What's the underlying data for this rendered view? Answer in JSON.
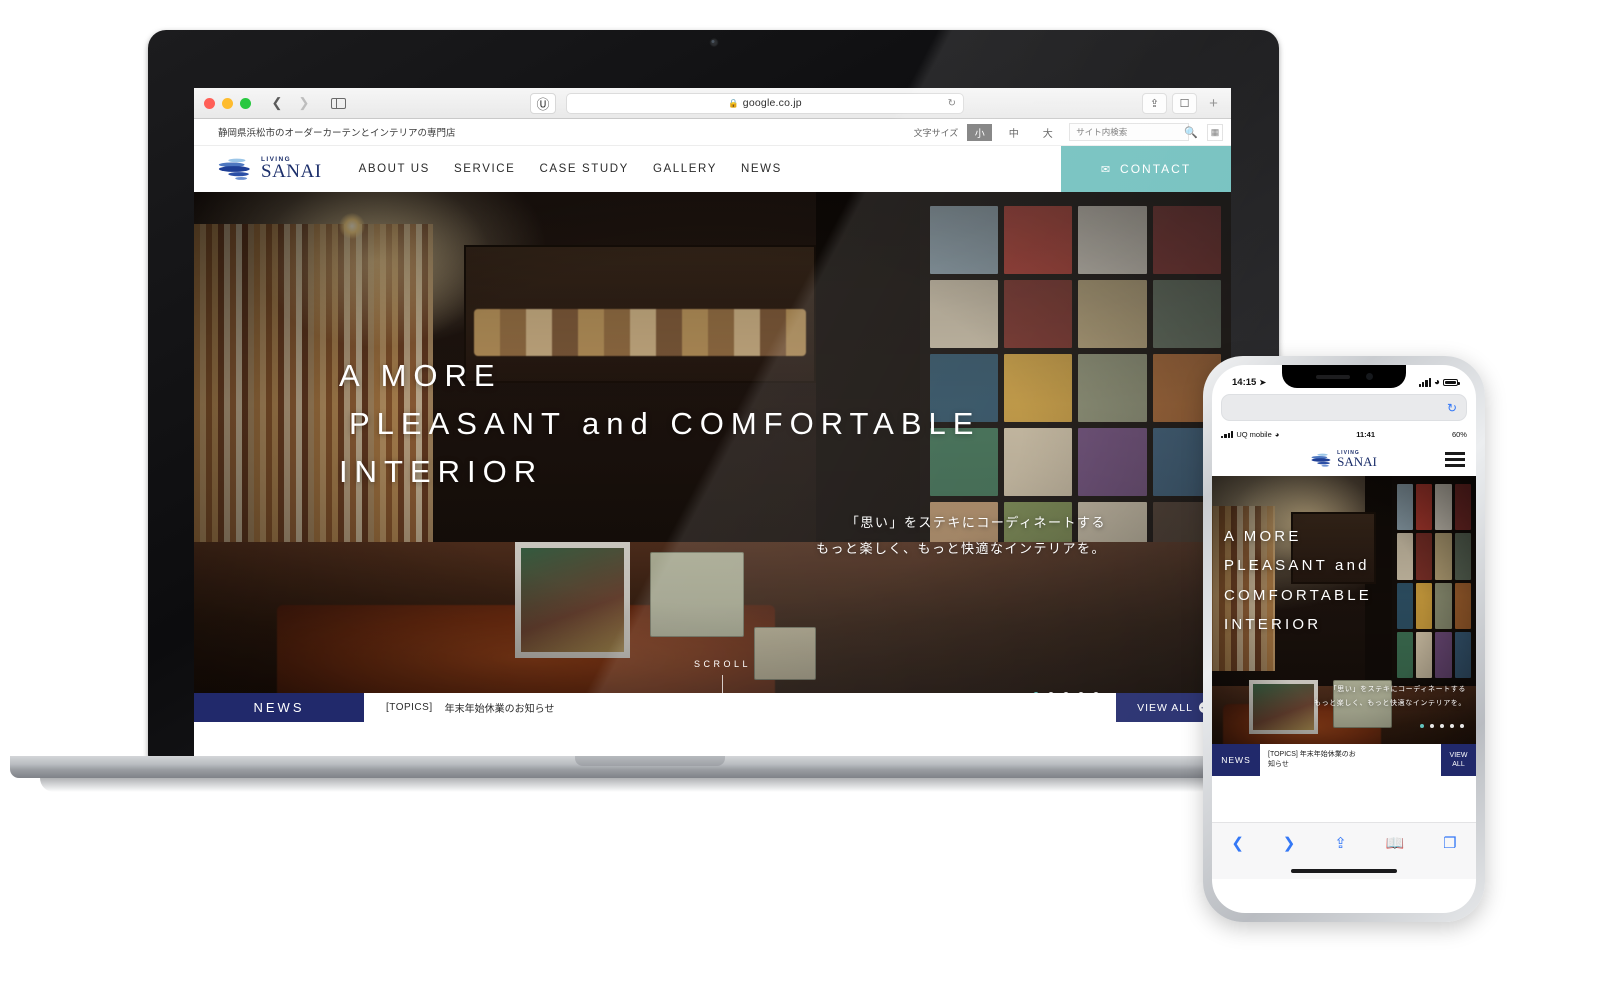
{
  "browser": {
    "url": "google.co.jp",
    "lock_icon": "lock-icon",
    "pinterest_icon": "pinterest-icon",
    "reload_icon": "reload-icon",
    "back_icon": "chevron-left-icon",
    "forward_icon": "chevron-right-icon",
    "sidebar_icon": "sidebar-icon",
    "share_icon": "share-icon",
    "tabs_icon": "tabs-icon",
    "new_tab_label": "+"
  },
  "site": {
    "utility": {
      "tagline": "静岡県浜松市のオーダーカーテンとインテリアの専門店",
      "fontsize_label": "文字サイズ",
      "fontsize_options": [
        "小",
        "中",
        "大"
      ],
      "fontsize_selected": "小",
      "search_placeholder": "サイト内検索",
      "search_value": "",
      "search_icon": "magnifier-icon",
      "lang_icon": "language-icon"
    },
    "logo": {
      "small": "LIVING",
      "large": "SANAI",
      "mark": "wave-logo-icon"
    },
    "nav": [
      "ABOUT US",
      "SERVICE",
      "CASE STUDY",
      "GALLERY",
      "NEWS"
    ],
    "contact": {
      "label": "CONTACT",
      "icon": "envelope-icon",
      "color": "#6fbfbd"
    },
    "hero": {
      "line1": "A MORE",
      "line2": "PLEASANT and COMFORTABLE",
      "line3": "INTERIOR",
      "sub1": "「思い」をステキにコーディネートする",
      "sub2": "もっと楽しく、もっと快適なインテリアを。",
      "scroll_label": "SCROLL",
      "slide_count": 5,
      "slide_active": 1,
      "active_dot_color": "#63c4bf"
    },
    "news": {
      "label": "NEWS",
      "tag": "[TOPICS]",
      "title": "年末年始休業のお知らせ",
      "view_all": "VIEW ALL",
      "view_all_icon": "arrow-right-circle-icon",
      "bar_color": "#21296b"
    }
  },
  "phone": {
    "outer_status": {
      "time": "14:15",
      "location_icon": "location-arrow-icon",
      "signal_icon": "cellular-bars-icon",
      "wifi_icon": "wifi-icon",
      "battery_icon": "battery-icon"
    },
    "inner_status": {
      "carrier": "UQ mobile",
      "wifi_icon": "wifi-icon",
      "time": "11:41",
      "battery": "60%"
    },
    "logo": {
      "small": "LIVING",
      "large": "SANAI"
    },
    "menu_icon": "hamburger-menu-icon",
    "hero": {
      "line1": "A MORE",
      "line2": "PLEASANT and",
      "line3": "COMFORTABLE",
      "line4": "INTERIOR",
      "sub1": "「思い」をステキにコーディネートする",
      "sub2": "もっと楽しく、もっと快適なインテリアを。",
      "slide_count": 5,
      "slide_active": 1
    },
    "news": {
      "label": "NEWS",
      "tag": "[TOPICS]",
      "title": "年末年始休業のお",
      "title2": "知らせ",
      "view_all_1": "VIEW",
      "view_all_2": "ALL"
    },
    "toolbar": [
      "back-icon",
      "forward-icon",
      "share-icon",
      "bookmarks-icon",
      "tabs-icon"
    ]
  }
}
